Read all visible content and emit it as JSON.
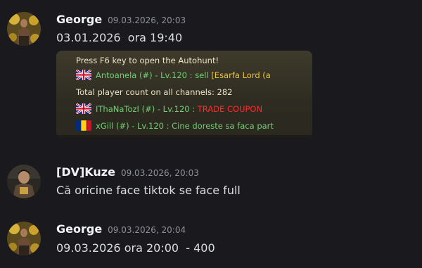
{
  "messages": [
    {
      "author": "George",
      "timestamp": "09.03.2026, 20:03",
      "text": "03.01.2026  ora 19:40",
      "attachment": {
        "lines": [
          {
            "parts": [
              "Press F6 key to open the Autohunt!"
            ]
          },
          {
            "flag": "uk",
            "parts": [
              "Antoanela (#) - Lv.120 : sell ",
              "[Esarfa Lord (a"
            ]
          },
          {
            "parts": [
              "Total player count on all channels: 282"
            ]
          },
          {
            "flag": "uk",
            "parts": [
              "IThaNaTozI (#) - Lv.120 : ",
              "TRADE COUPON"
            ]
          },
          {
            "flag": "ro",
            "parts": [
              "xGill (#) - Lv.120 : Cine doreste sa faca part"
            ]
          }
        ]
      }
    },
    {
      "author": "[DV]Kuze",
      "timestamp": "09.03.2026, 20:03",
      "text": "Că oricine face tiktok se face full"
    },
    {
      "author": "George",
      "timestamp": "09.03.2026, 20:04",
      "text": "09.03.2026 ora 20:00  - 400"
    }
  ],
  "colors": {
    "background": "#1a1a1e",
    "author": "#f2f3f5",
    "timestamp": "#8e9098",
    "text": "#dbdee1",
    "game_green": "#6fd06f",
    "game_yellow": "#f0c530",
    "game_red": "#ff2a2a"
  }
}
